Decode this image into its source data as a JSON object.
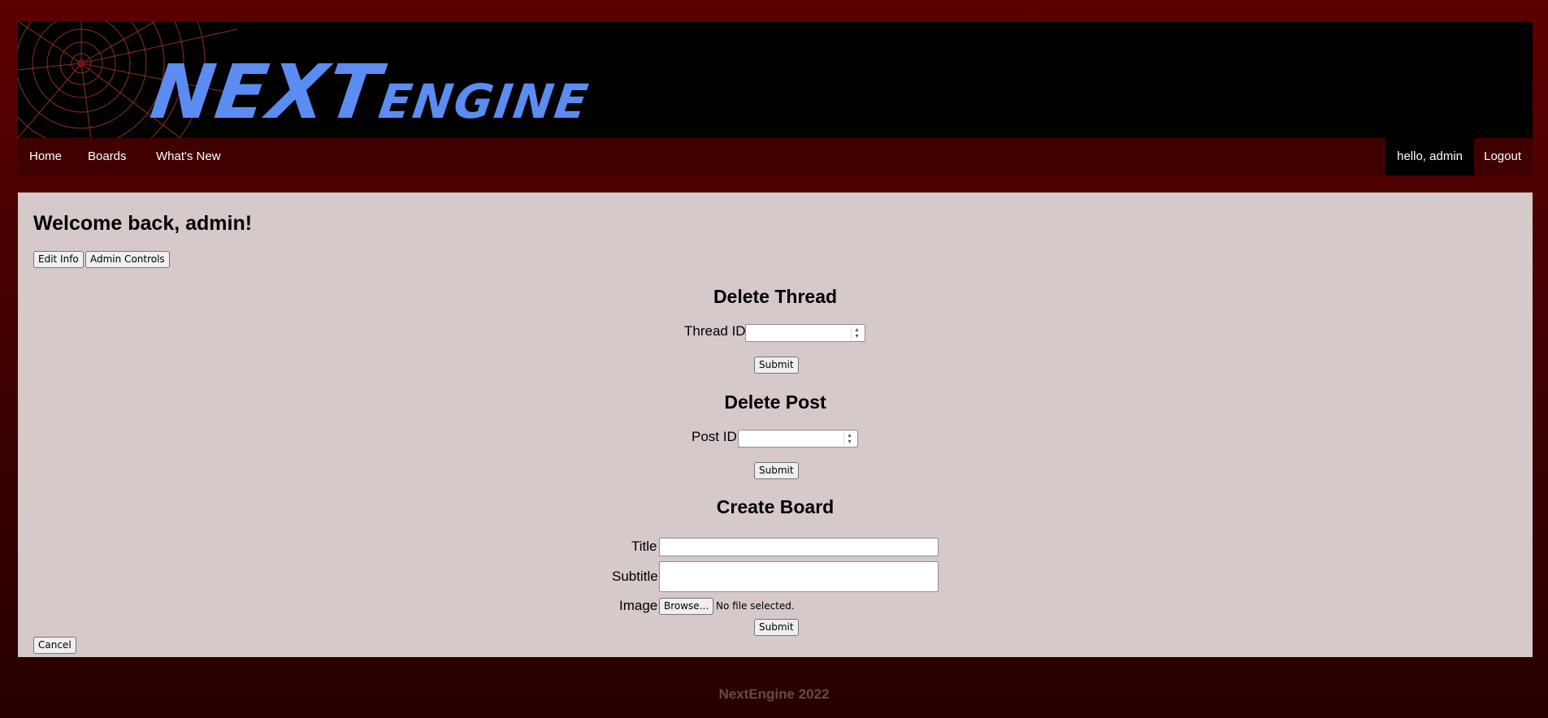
{
  "banner": {
    "logo_main": "NEXT",
    "logo_sub": "engine"
  },
  "nav": {
    "home": "Home",
    "boards": "Boards",
    "whats_new": "What's New",
    "greeting": "hello, admin",
    "logout": "Logout"
  },
  "main": {
    "welcome": "Welcome back, admin!",
    "edit_info": "Edit Info",
    "admin_controls": "Admin Controls",
    "delete_thread": {
      "title": "Delete Thread",
      "label": "Thread ID",
      "value": "",
      "submit": "Submit"
    },
    "delete_post": {
      "title": "Delete Post",
      "label": "Post ID",
      "value": "",
      "submit": "Submit"
    },
    "create_board": {
      "title": "Create Board",
      "title_label": "Title",
      "title_value": "",
      "subtitle_label": "Subtitle",
      "subtitle_value": "",
      "image_label": "Image",
      "browse": "Browse...",
      "file_status": "No file selected.",
      "submit": "Submit"
    },
    "cancel": "Cancel"
  },
  "footer": {
    "text": "NextEngine 2022"
  },
  "colors": {
    "background": "#5c0000",
    "navbar": "#400000",
    "content": "#d5c9c9",
    "logo": "#5b8cf2"
  }
}
